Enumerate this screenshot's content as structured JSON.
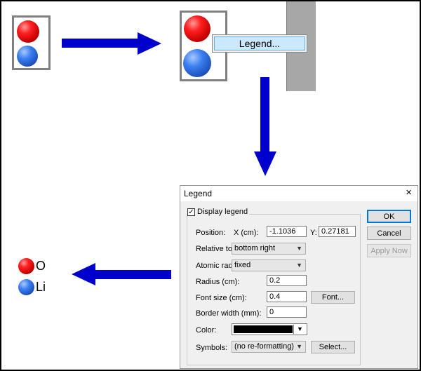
{
  "context_menu": {
    "item_label": "Legend..."
  },
  "dialog": {
    "title": "Legend",
    "close_glyph": "×",
    "display_legend": {
      "label": "Display legend",
      "checked": true
    },
    "position": {
      "label": "Position:",
      "x_label": "X (cm):",
      "x_value": "-1.1036",
      "y_label": "Y:",
      "y_value": "0.27181"
    },
    "relative_to": {
      "label": "Relative to:",
      "value": "bottom right"
    },
    "atomic_radii": {
      "label": "Atomic radii:",
      "value": "fixed"
    },
    "radius": {
      "label": "Radius (cm):",
      "value": "0.2"
    },
    "font_size": {
      "label": "Font size (cm):",
      "value": "0.4",
      "button": "Font..."
    },
    "border_width": {
      "label": "Border width (mm):",
      "value": "0"
    },
    "color": {
      "label": "Color:",
      "value_hex": "#000000"
    },
    "symbols": {
      "label": "Symbols:",
      "value": "(no re-formatting)",
      "button": "Select..."
    },
    "buttons": {
      "ok": "OK",
      "cancel": "Cancel",
      "apply_now": "Apply Now"
    }
  },
  "result_legend": {
    "entries": [
      "O",
      "Li"
    ]
  },
  "colors": {
    "arrow": "#0000cc",
    "oxygen": "#ff0000",
    "lithium": "#2f6fe0"
  }
}
